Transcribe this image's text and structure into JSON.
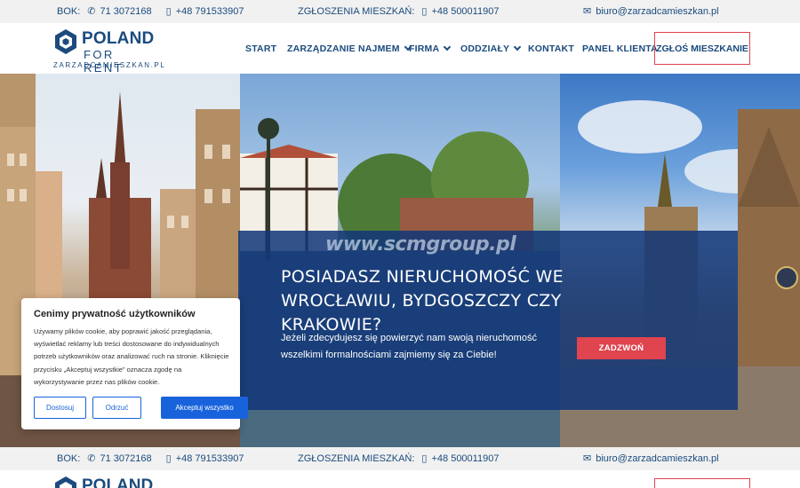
{
  "topbar": {
    "bok_label": "BOK:",
    "phone1": "71 3072168",
    "phone2": "+48 791533907",
    "reports_label": "ZGŁOSZENIA MIESZKAŃ:",
    "phone3": "+48 500011907",
    "email": "biuro@zarzadcamieszkan.pl"
  },
  "logo": {
    "line1": "POLAND",
    "line2": "FOR RENT",
    "line3": "ZARZADCAMIESZKAN.PL"
  },
  "nav": {
    "start": "START",
    "management": "ZARZĄDZANIE NAJMEM",
    "company": "FIRMA",
    "branches": "ODDZIAŁY",
    "contact": "KONTAKT",
    "client_panel": "PANEL KLIENTA",
    "cta": "ZGŁOŚ MIESZKANIE"
  },
  "hero": {
    "watermark": "www.scmgroup.pl",
    "title": "POSIADASZ NIERUCHOMOŚĆ WE WROCŁAWIU, BYDGOSZCZY CZY KRAKOWIE?",
    "text": "Jeżeli zdecydujesz się powierzyć nam swoją nieruchomość wszelkimi formalnościami zajmiemy się za Ciebie!",
    "call_button": "ZADZWOŃ"
  },
  "cookie": {
    "title": "Cenimy prywatność użytkowników",
    "text": "Używamy plików cookie, aby poprawić jakość przeglądania, wyświetlać reklamy lub treści dostosowane do indywidualnych potrzeb użytkowników oraz analizować ruch na stronie. Kliknięcie przycisku „Akceptuj wszystkie” oznacza zgodę na wykorzystywanie przez nas plików cookie.",
    "customize": "Dostosuj",
    "reject": "Odrzuć",
    "accept_all": "Akceptuj wszystko"
  },
  "icons": {
    "phone_fixed": "phone-icon",
    "phone_mobile": "mobile-phone-icon",
    "mail": "envelope-icon"
  },
  "colors": {
    "brand_blue": "#1b4b7d",
    "accent_red": "#e0444f",
    "overlay_blue": "#12377a",
    "cookie_blue": "#1863dc"
  }
}
